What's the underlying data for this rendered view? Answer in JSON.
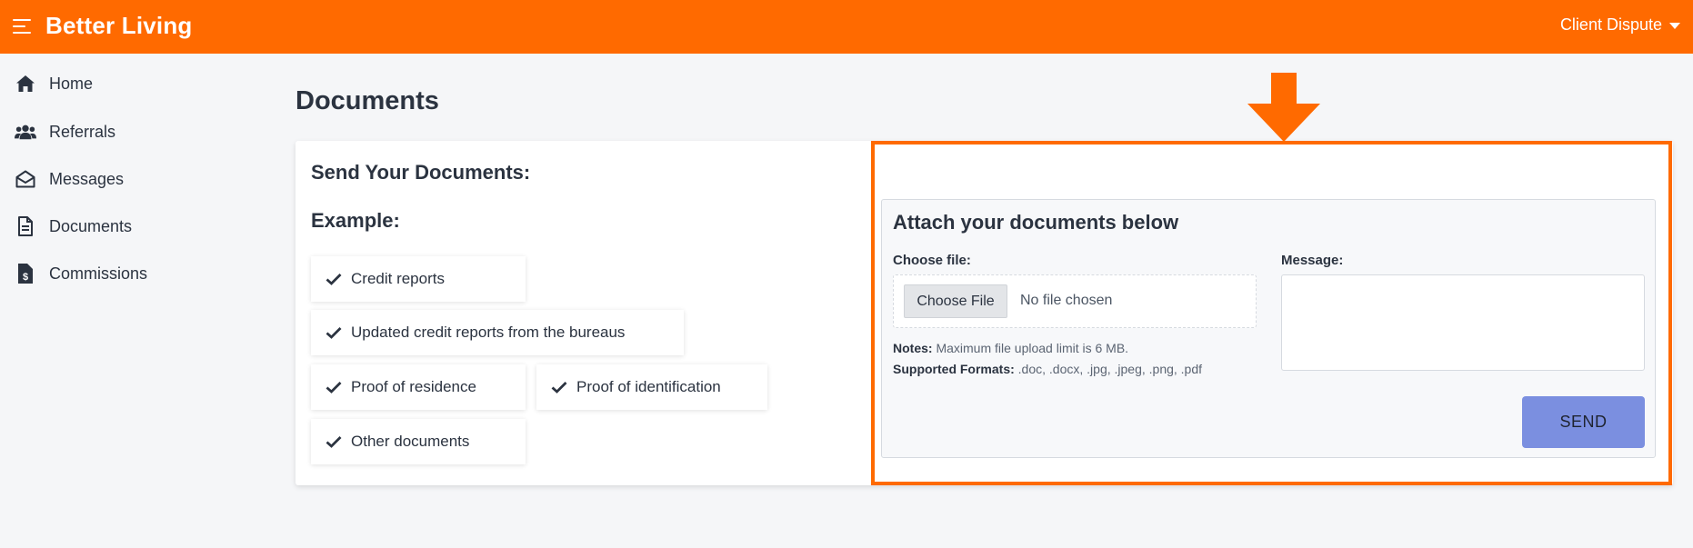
{
  "app": {
    "brand": "Better Living",
    "user_menu_label": "Client Dispute"
  },
  "colors": {
    "topbar": "#ff6a00",
    "accent": "#ff6a00",
    "send_button": "#7b8fe0"
  },
  "sidebar": {
    "items": [
      {
        "label": "Home",
        "icon": "home-icon"
      },
      {
        "label": "Referrals",
        "icon": "users-icon"
      },
      {
        "label": "Messages",
        "icon": "envelope-open-icon"
      },
      {
        "label": "Documents",
        "icon": "file-document-icon"
      },
      {
        "label": "Commissions",
        "icon": "file-dollar-icon"
      }
    ]
  },
  "main": {
    "page_title": "Documents",
    "send_title": "Send Your Documents:",
    "example_title": "Example:",
    "examples": [
      "Credit reports",
      "Updated credit reports from the bureaus",
      "Proof of residence",
      "Proof of identification",
      "Other documents"
    ],
    "attach": {
      "title": "Attach your documents below",
      "choose_file_label": "Choose file:",
      "choose_file_button": "Choose File",
      "no_file_text": "No file chosen",
      "notes_label": "Notes:",
      "notes_text": "Maximum file upload limit is 6 MB.",
      "formats_label": "Supported Formats:",
      "formats_text": ".doc, .docx, .jpg, .jpeg, .png, .pdf",
      "message_label": "Message:",
      "message_value": "",
      "send_button": "SEND"
    }
  }
}
